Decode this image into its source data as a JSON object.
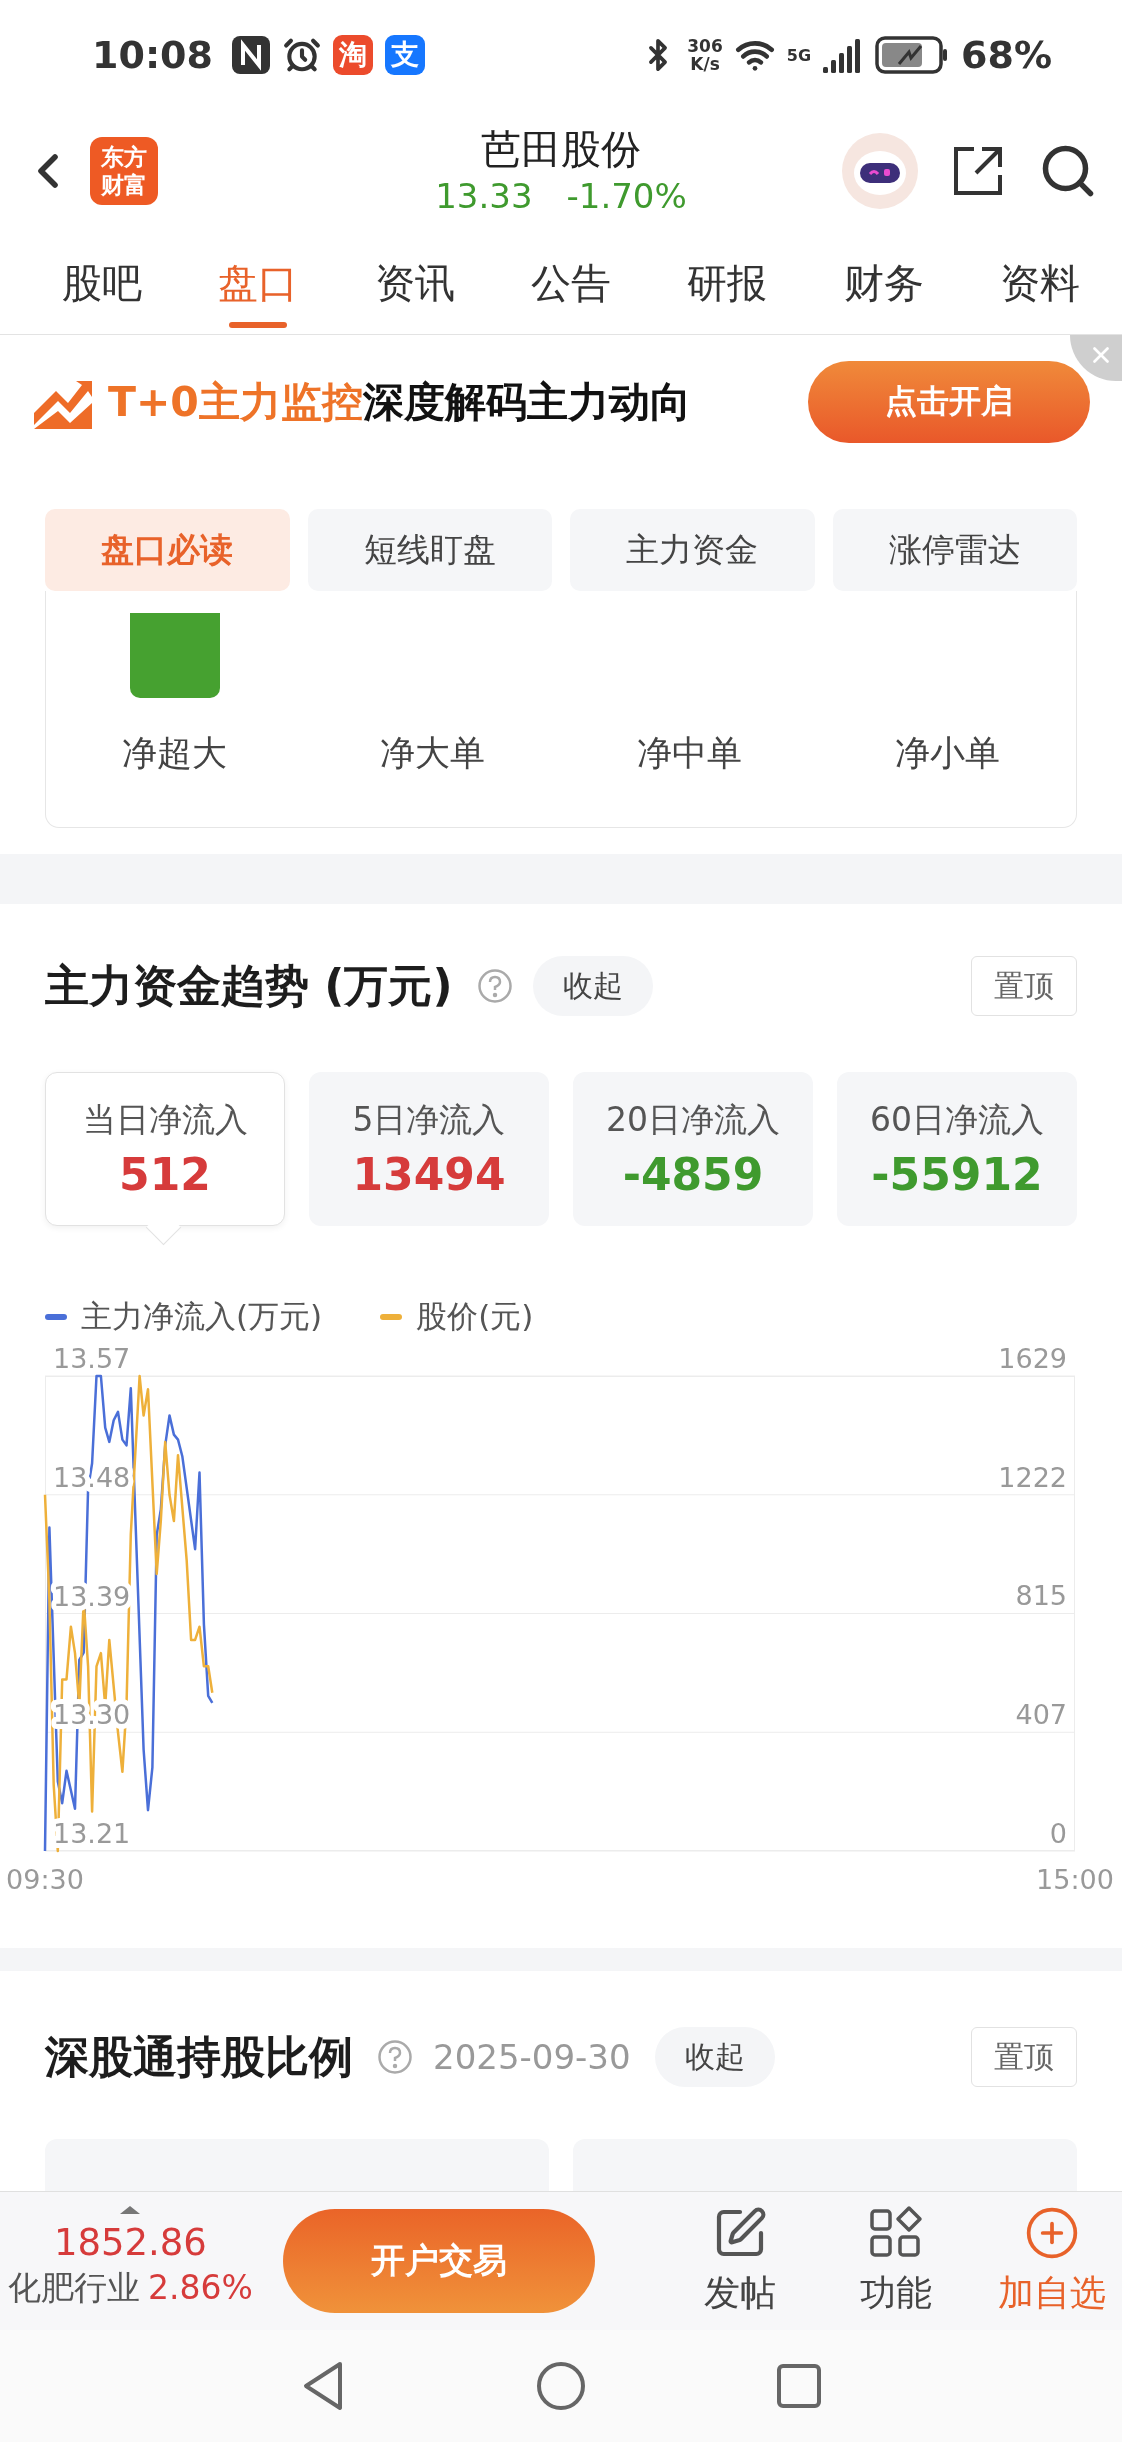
{
  "status_bar": {
    "time": "10:08",
    "apps": [
      {
        "glyph": "淘",
        "color": "#ec4b2c"
      },
      {
        "glyph": "支",
        "color": "#1677ff"
      }
    ],
    "speed_value": "306",
    "speed_unit": "K/s",
    "network": "5G",
    "battery": "68%"
  },
  "header": {
    "logo": "东方财富",
    "title": "芭田股份",
    "price": "13.33",
    "change": "-1.70%"
  },
  "tabs": [
    {
      "label": "股吧",
      "selected": false
    },
    {
      "label": "盘口",
      "selected": true
    },
    {
      "label": "资讯",
      "selected": false
    },
    {
      "label": "公告",
      "selected": false
    },
    {
      "label": "研报",
      "selected": false
    },
    {
      "label": "财务",
      "selected": false
    },
    {
      "label": "资料",
      "selected": false
    }
  ],
  "banner": {
    "highlight": "T+0主力监控",
    "text": "深度解码主力动向",
    "button": "点击开启"
  },
  "sub_tabs": [
    {
      "label": "盘口必读",
      "selected": true
    },
    {
      "label": "短线盯盘",
      "selected": false
    },
    {
      "label": "主力资金",
      "selected": false
    },
    {
      "label": "涨停雷达",
      "selected": false
    }
  ],
  "flow_card": {
    "labels": [
      "净超大",
      "净大单",
      "净中单",
      "净小单"
    ]
  },
  "trend": {
    "title": "主力资金趋势 (万元)",
    "collapse": "收起",
    "pin": "置顶",
    "stats": [
      {
        "label": "当日净流入",
        "value": "512",
        "color": "#d63b3b",
        "selected": true
      },
      {
        "label": "5日净流入",
        "value": "13494",
        "color": "#d63b3b",
        "selected": false
      },
      {
        "label": "20日净流入",
        "value": "-4859",
        "color": "#3f9a2e",
        "selected": false
      },
      {
        "label": "60日净流入",
        "value": "-55912",
        "color": "#3f9a2e",
        "selected": false
      }
    ],
    "chart_data": {
      "type": "line",
      "grid": true,
      "xlim": [
        570,
        900
      ],
      "xticks": [
        {
          "value": 570,
          "label": "09:30"
        },
        {
          "value": 900,
          "label": "15:00"
        }
      ],
      "ylim": [
        13.21,
        13.57
      ],
      "yticks": [
        {
          "value": 13.21,
          "label": "13.21"
        },
        {
          "value": 13.3,
          "label": "13.30"
        },
        {
          "value": 13.39,
          "label": "13.39"
        },
        {
          "value": 13.48,
          "label": "13.48"
        },
        {
          "value": 13.57,
          "label": "13.57"
        }
      ],
      "y2lim": [
        0,
        1629
      ],
      "y2ticks": [
        0,
        407,
        815,
        1222,
        1629
      ],
      "series": [
        {
          "name": "主力净流入(万元)",
          "color": "#4a6fd8",
          "axis": "y2",
          "x": [
            570,
            571.4,
            574.1,
            575.5,
            576.9,
            579.6,
            581,
            582.4,
            583.8,
            585.1,
            586.5,
            587.9,
            589.3,
            590.6,
            592,
            593.4,
            594.8,
            596.1,
            597.5,
            601.6,
            603,
            604.4,
            605.8,
            607.1,
            608.5,
            609.9,
            611.3,
            612.6,
            614,
            618.1,
            619.5,
            620.9,
            622.3,
            623.6
          ],
          "values": [
            0,
            1109,
            238,
            164,
            275,
            145,
            655,
            680,
            1244,
            1330,
            1629,
            1629,
            1452,
            1403,
            1477,
            1506,
            1411,
            1391,
            1587,
            348,
            140,
            287,
            1084,
            1170,
            1391,
            1494,
            1428,
            1411,
            1354,
            1035,
            1298,
            778,
            532,
            508
          ]
        },
        {
          "name": "股价(元)",
          "color": "#eeb03a",
          "x": [
            570,
            571.4,
            572.8,
            574.1,
            575.5,
            576.9,
            578.3,
            579.6,
            581,
            582.4,
            583.8,
            585.1,
            586.5,
            587.9,
            589.3,
            590.6,
            593.4,
            594.8,
            596.1,
            597.5,
            600.3,
            601.6,
            603,
            605.8,
            607.1,
            608.5,
            609.9,
            611.3,
            612.6,
            615.4,
            616.8,
            618.1,
            619.5,
            620.9,
            622.3,
            623.6
          ],
          "values": [
            13.48,
            13.4,
            13.26,
            13.21,
            13.34,
            13.34,
            13.38,
            13.36,
            13.32,
            13.4,
            13.35,
            13.24,
            13.35,
            13.36,
            13.32,
            13.37,
            13.3,
            13.27,
            13.32,
            13.45,
            13.57,
            13.54,
            13.56,
            13.42,
            13.46,
            13.52,
            13.48,
            13.46,
            13.51,
            13.43,
            13.37,
            13.37,
            13.38,
            13.35,
            13.35,
            13.33
          ]
        }
      ]
    }
  },
  "holding": {
    "title": "深股通持股比例",
    "date": "2025-09-30",
    "collapse": "收起",
    "pin": "置顶"
  },
  "bottom_bar": {
    "index_value": "1852.86",
    "industry": "化肥行业",
    "industry_change": "2.86%",
    "trade_button": "开户交易",
    "actions": [
      {
        "label": "发帖",
        "kind": "post"
      },
      {
        "label": "功能",
        "kind": "apps"
      },
      {
        "label": "加自选",
        "kind": "add"
      }
    ]
  }
}
